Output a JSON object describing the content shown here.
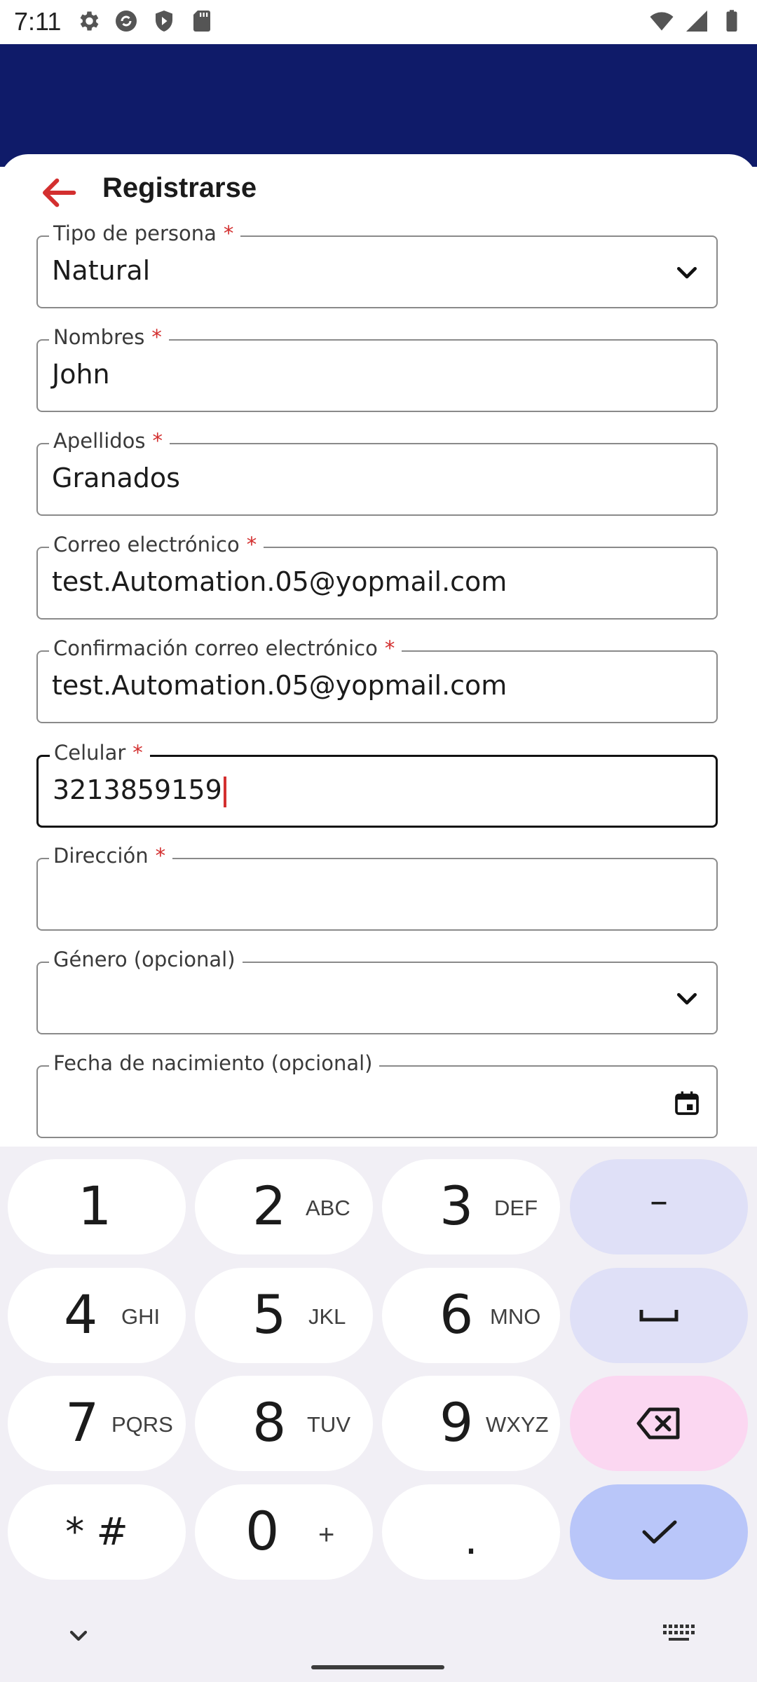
{
  "status_bar": {
    "time": "7:11",
    "left_icons": [
      "gear-icon",
      "sync-icon",
      "shield-play-icon",
      "sd-card-icon"
    ],
    "right_icons": [
      "wifi-icon",
      "signal-icon",
      "battery-icon"
    ]
  },
  "colors": {
    "header": "#0f1b69",
    "back_arrow": "#d32f2f",
    "required_asterisk": "#d32f2f",
    "caret": "#d32f2f"
  },
  "header": {
    "title": "Registrarse",
    "back_icon": "arrow-back-icon"
  },
  "form": {
    "tipo_persona": {
      "label": "Tipo de persona",
      "required": "*",
      "value": "Natural",
      "icon": "chevron-down-icon"
    },
    "nombres": {
      "label": "Nombres",
      "required": "*",
      "value": "John"
    },
    "apellidos": {
      "label": "Apellidos",
      "required": "*",
      "value": "Granados"
    },
    "correo": {
      "label": "Correo electrónico",
      "required": "*",
      "value": "test.Automation.05@yopmail.com"
    },
    "confirmacion_correo": {
      "label": "Confirmación correo electrónico",
      "required": "*",
      "value": "test.Automation.05@yopmail.com"
    },
    "celular": {
      "label": "Celular",
      "required": "*",
      "value": "3213859159"
    },
    "direccion": {
      "label": "Dirección",
      "required": "*",
      "value": ""
    },
    "genero": {
      "label": "Género (opcional)",
      "value": "",
      "icon": "chevron-down-icon"
    },
    "fecha_nacimiento": {
      "label": "Fecha de nacimiento (opcional)",
      "value": "",
      "icon": "calendar-icon"
    }
  },
  "keyboard": {
    "keys": [
      {
        "num": "1",
        "sub": ""
      },
      {
        "num": "2",
        "sub": "ABC"
      },
      {
        "num": "3",
        "sub": "DEF"
      },
      {
        "num": "4",
        "sub": "GHI"
      },
      {
        "num": "5",
        "sub": "JKL"
      },
      {
        "num": "6",
        "sub": "MNO"
      },
      {
        "num": "7",
        "sub": "PQRS"
      },
      {
        "num": "8",
        "sub": "TUV"
      },
      {
        "num": "9",
        "sub": "WXYZ"
      },
      {
        "num": "0",
        "sub": "+"
      }
    ],
    "symbols_key": "* #",
    "period_key": ".",
    "minus_key": "–",
    "side_icons": [
      "space-icon",
      "backspace-icon",
      "checkmark-icon"
    ],
    "bottom_icons": [
      "chevron-down-icon",
      "keyboard-icon"
    ]
  }
}
